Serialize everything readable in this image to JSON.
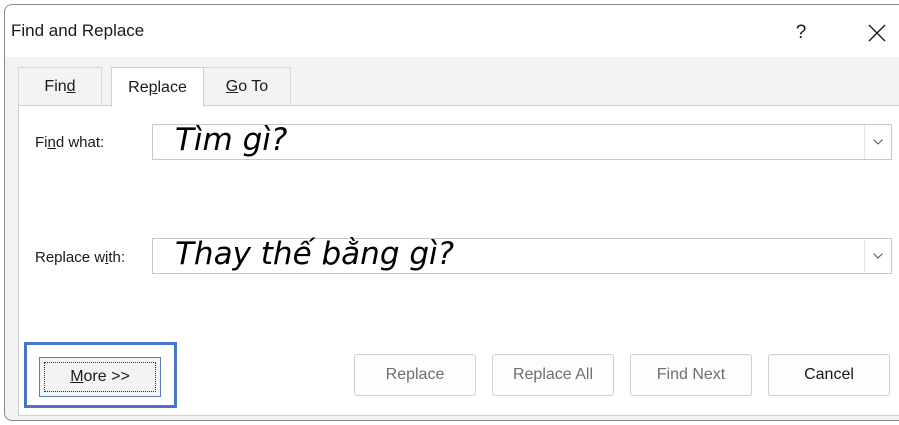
{
  "window": {
    "title": "Find and Replace",
    "help_label": "?",
    "close_icon": "close-icon"
  },
  "tabs": [
    {
      "label_pre": "Fin",
      "label_key": "d",
      "label_post": "",
      "active": false
    },
    {
      "label_pre": "Re",
      "label_key": "p",
      "label_post": "lace",
      "active": true
    },
    {
      "label_pre": "",
      "label_key": "G",
      "label_post": "o To",
      "active": false
    }
  ],
  "find": {
    "label_pre": "Fi",
    "label_key": "n",
    "label_post": "d what:",
    "value": "Tìm gì?"
  },
  "replace": {
    "label_pre": "Replace w",
    "label_key": "i",
    "label_post": "th:",
    "value": "Thay thế bằng gì?"
  },
  "buttons": {
    "more_key": "M",
    "more_rest": "ore >>",
    "replace": "Replace",
    "replace_all": "Replace All",
    "find_next": "Find Next",
    "cancel": "Cancel"
  },
  "colors": {
    "highlight": "#4a74c9",
    "dialog_bg": "#f3f3f3"
  }
}
